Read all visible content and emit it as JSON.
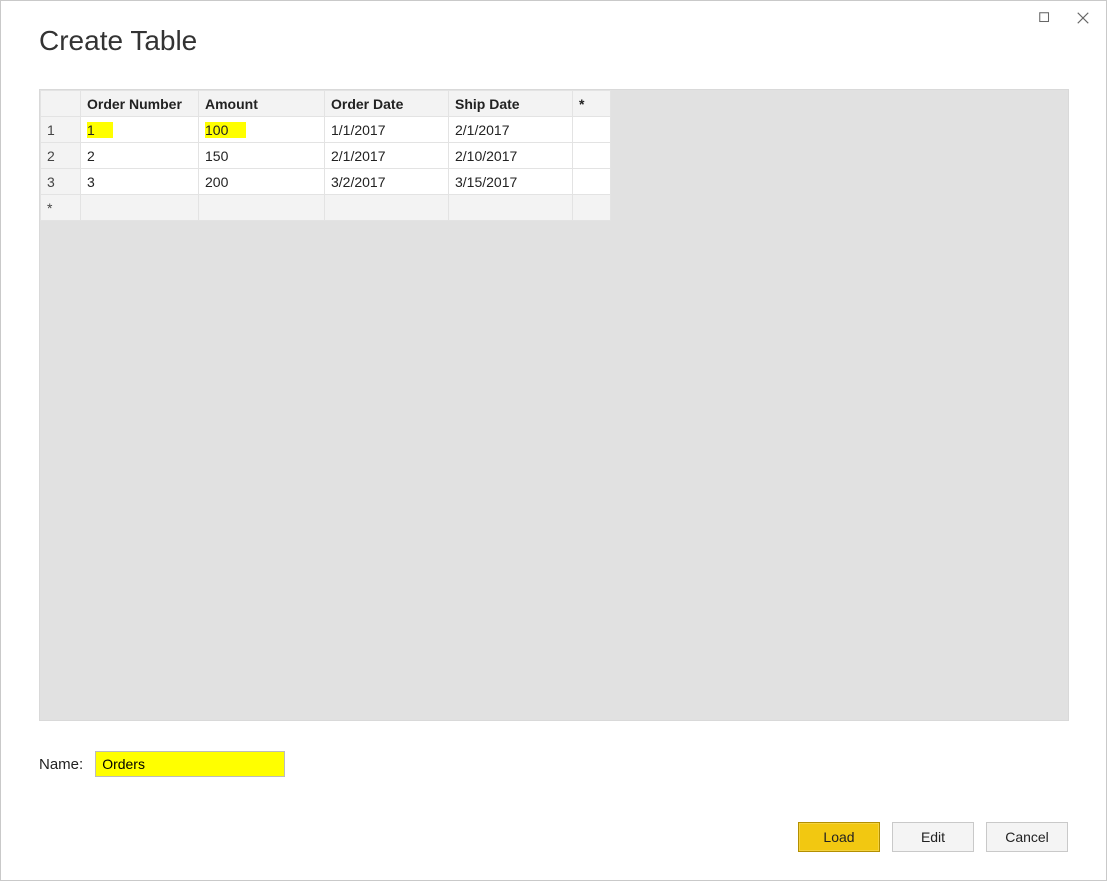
{
  "window": {
    "title": "Create Table"
  },
  "table": {
    "star_header": "*",
    "star_row": "*",
    "headers": {
      "order_number": "Order Number",
      "amount": "Amount",
      "order_date": "Order Date",
      "ship_date": "Ship Date"
    },
    "rows": [
      {
        "n": "1",
        "order_number": "1",
        "amount": "100",
        "order_date": "1/1/2017",
        "ship_date": "2/1/2017"
      },
      {
        "n": "2",
        "order_number": "2",
        "amount": "150",
        "order_date": "2/1/2017",
        "ship_date": "2/10/2017"
      },
      {
        "n": "3",
        "order_number": "3",
        "amount": "200",
        "order_date": "3/2/2017",
        "ship_date": "3/15/2017"
      }
    ]
  },
  "name_field": {
    "label": "Name:",
    "value": "Orders"
  },
  "buttons": {
    "load": "Load",
    "edit": "Edit",
    "cancel": "Cancel"
  }
}
